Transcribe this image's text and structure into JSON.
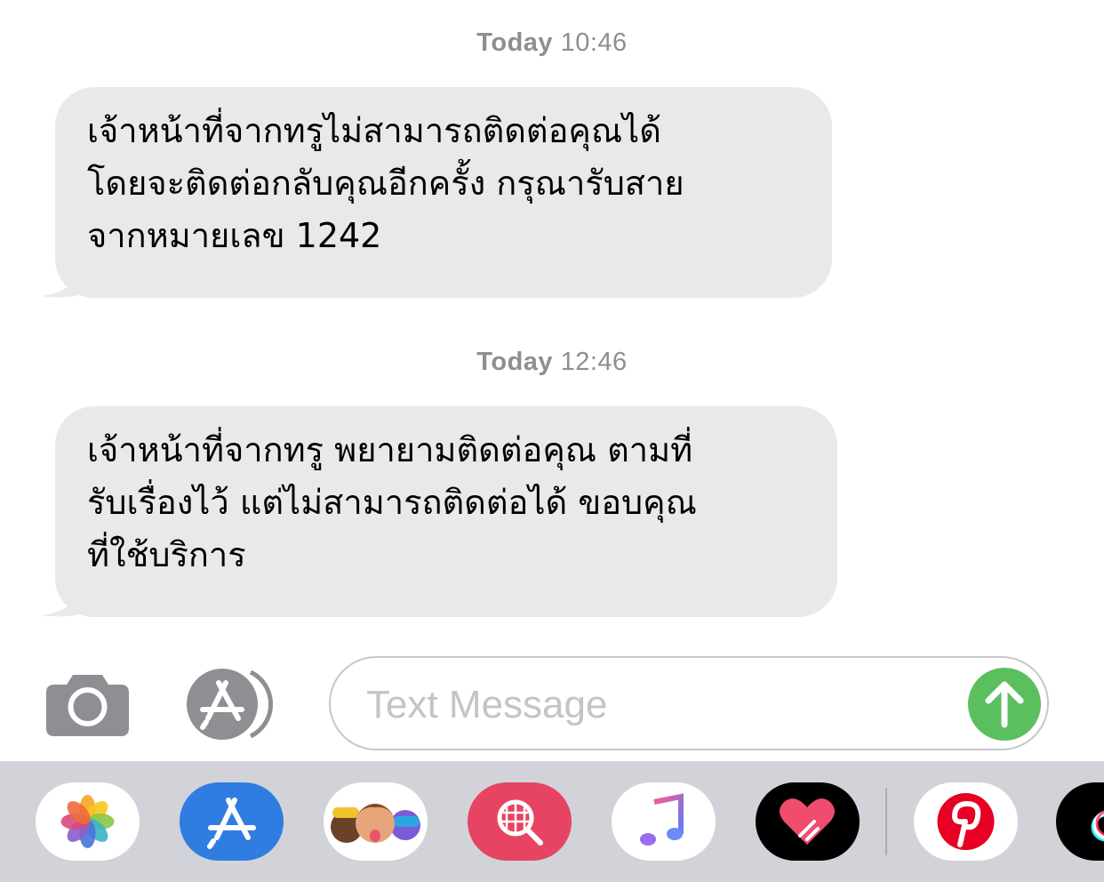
{
  "messages": [
    {
      "timestamp_day": "Today",
      "timestamp_time": "10:46",
      "lines": [
        "เจ้าหน้าที่จากทรูไม่สามารถติดต่อคุณได้",
        "โดยจะติดต่อกลับคุณอีกครั้ง กรุณารับสาย",
        "จากหมายเลข 1242"
      ]
    },
    {
      "timestamp_day": "Today",
      "timestamp_time": "12:46",
      "lines": [
        "เจ้าหน้าที่จากทรู พยายามติดต่อคุณ ตามที่",
        "รับเรื่องไว้ แต่ไม่สามารถติดต่อได้ ขอบคุณ",
        "ที่ใช้บริการ"
      ]
    }
  ],
  "composer": {
    "placeholder": "Text Message",
    "camera_icon": "camera-icon",
    "apps_icon": "app-store-icon",
    "send_icon": "send-arrow-icon"
  },
  "app_drawer": {
    "apps": [
      {
        "name": "photos",
        "icon": "photos-icon"
      },
      {
        "name": "app-store",
        "icon": "app-store-icon"
      },
      {
        "name": "memoji",
        "icon": "memoji-icon"
      },
      {
        "name": "images-search",
        "icon": "images-search-icon"
      },
      {
        "name": "music",
        "icon": "music-icon"
      },
      {
        "name": "digital-touch",
        "icon": "digital-touch-icon"
      },
      {
        "name": "pinterest",
        "icon": "pinterest-icon"
      },
      {
        "name": "tiktok",
        "icon": "tiktok-icon"
      }
    ]
  },
  "colors": {
    "bubble_received": "#e9e9eb",
    "timestamp": "#8e8e93",
    "send_button": "#5cbf5f",
    "drawer_bg": "#d1d3d9"
  }
}
